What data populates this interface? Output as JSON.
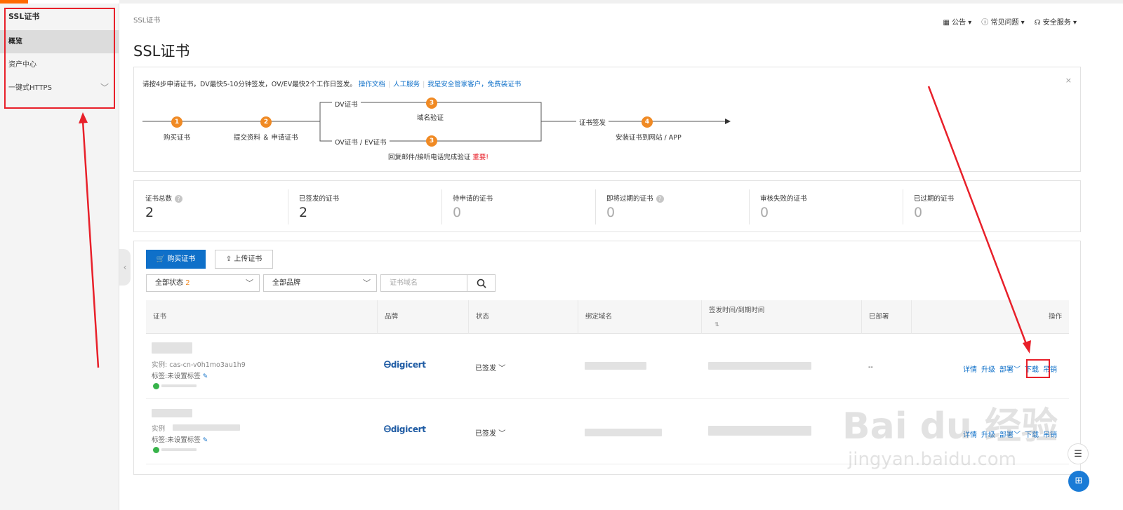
{
  "sidebar": {
    "title": "SSL证书",
    "items": [
      {
        "label": "概览"
      },
      {
        "label": "资产中心"
      },
      {
        "label": "一键式HTTPS"
      }
    ]
  },
  "header": {
    "breadcrumb": "SSL证书",
    "title": "SSL证书",
    "links": [
      {
        "label": "公告",
        "icon": "calendar-icon"
      },
      {
        "label": "常见问题",
        "icon": "question-icon"
      },
      {
        "label": "安全服务",
        "icon": "headset-icon"
      }
    ]
  },
  "guide": {
    "intro": "请按4步申请证书，DV最快5-10分钟签发，OV/EV最快2个工作日签发。",
    "links": [
      "操作文档",
      "人工服务",
      "我是安全管家客户，免费装证书"
    ],
    "close": "×",
    "flow": {
      "step1_num": "1",
      "step1_label": "购买证书",
      "step2_num": "2",
      "step2_label": "提交资料 ＆ 申请证书",
      "dv_label": "DV证书",
      "step3a_num": "3",
      "step3a_label": "域名验证",
      "ovev_label": "OV证书 / EV证书",
      "step3b_num": "3",
      "step3b_label": "回复邮件/接听电话完成验证",
      "important": "重要!",
      "issue_label": "证书签发",
      "step4_num": "4",
      "step4_label": "安装证书到网站 / APP"
    }
  },
  "stats": [
    {
      "label": "证书总数",
      "value": "2",
      "help": true
    },
    {
      "label": "已签发的证书",
      "value": "2",
      "help": false
    },
    {
      "label": "待申请的证书",
      "value": "0",
      "help": false
    },
    {
      "label": "即将过期的证书",
      "value": "0",
      "help": true
    },
    {
      "label": "审核失败的证书",
      "value": "0",
      "help": false
    },
    {
      "label": "已过期的证书",
      "value": "0",
      "help": false
    }
  ],
  "toolbar": {
    "buy_label": "购买证书",
    "upload_label": "上传证书",
    "status_filter": "全部状态",
    "status_count": "2",
    "brand_filter": "全部品牌",
    "search_placeholder": "证书域名"
  },
  "table": {
    "columns": [
      "证书",
      "品牌",
      "状态",
      "绑定域名",
      "签发时间/到期时间",
      "已部署",
      "操作"
    ],
    "rows": [
      {
        "instance": "实例: cas-cn-v0h1mo3au1h9",
        "tag": "标签:未设置标签",
        "brand": "digicert",
        "status": "已签发",
        "deployed": "--",
        "ops": [
          "详情",
          "升级",
          "部署",
          "下载",
          "吊销"
        ]
      },
      {
        "instance": "实例",
        "tag": "标签:未设置标签",
        "brand": "digicert",
        "status": "已签发",
        "deployed": "",
        "ops": [
          "详情",
          "升级",
          "部署",
          "下载",
          "吊销"
        ]
      }
    ]
  },
  "watermark": {
    "brand": "Bai du 经验",
    "url": "jingyan.baidu.com"
  },
  "colors": {
    "accent": "#ff6a00",
    "primary": "#0f70c9",
    "step": "#f08a24",
    "annotation": "#e8202a"
  }
}
